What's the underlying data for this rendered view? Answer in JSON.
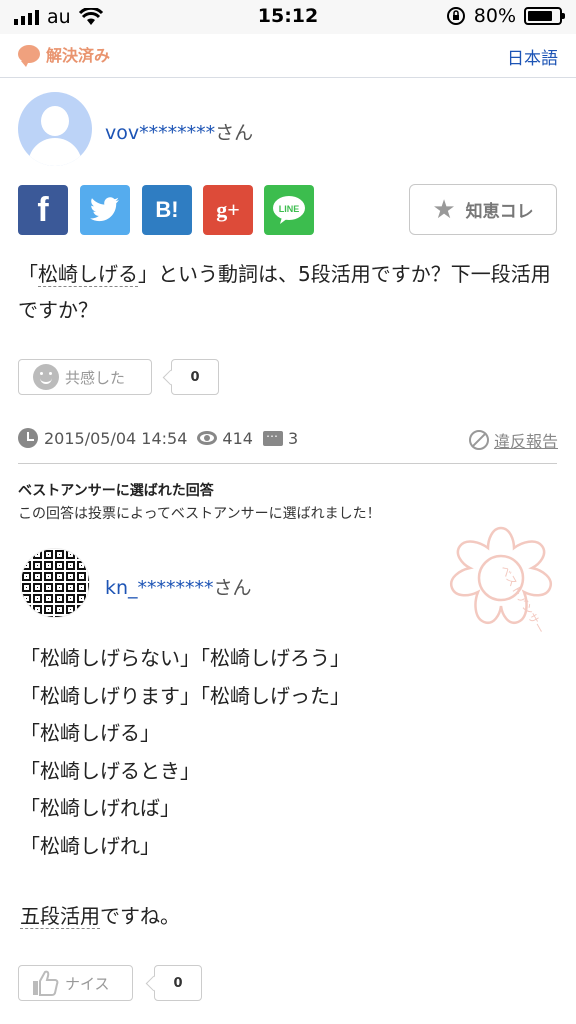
{
  "status_bar": {
    "carrier": "au",
    "time": "15:12",
    "battery": "80%",
    "battery_level": 0.8
  },
  "header": {
    "resolved_label": "解決済み",
    "language_link": "日本語"
  },
  "question": {
    "user_name": "vov********",
    "honorific": "さん",
    "share_buttons": [
      {
        "name": "facebook",
        "label": "f",
        "color": "#3b5998"
      },
      {
        "name": "twitter",
        "color": "#55acee"
      },
      {
        "name": "hatena",
        "label": "B!",
        "color": "#2f7dc2"
      },
      {
        "name": "google-plus",
        "label": "g+",
        "color": "#dd4b39"
      },
      {
        "name": "line",
        "label": "LINE",
        "color": "#3cbd4e"
      }
    ],
    "chiekore_label": "知恵コレ",
    "text_part1": "「",
    "text_term": "松崎しげる",
    "text_part2": "」という動詞は、5段活用ですか？下一段活用ですか？",
    "empathy_label": "共感した",
    "empathy_count": "0",
    "date": "2015/05/04 14:54",
    "views": "414",
    "answers": "3",
    "report_label": "違反報告"
  },
  "best_answer": {
    "heading": "ベストアンサーに選ばれた回答",
    "subheading": "この回答は投票によってベストアンサーに選ばれました！",
    "stamp_text": "ベストアンサー",
    "user_name": "kn_********",
    "honorific": "さん",
    "lines": [
      "「松崎しげらない」「松崎しげろう」",
      "「松崎しげります」「松崎しげった」",
      "「松崎しげる」",
      "「松崎しげるとき」",
      "「松崎しげれば」",
      "「松崎しげれ」"
    ],
    "conclusion_term": "五段活用",
    "conclusion_rest": "ですね。",
    "nice_label": "ナイス",
    "nice_count": "0"
  },
  "colors": {
    "link": "#1d54b5",
    "resolved": "#e9946f",
    "stamp": "#f3c9c0"
  }
}
